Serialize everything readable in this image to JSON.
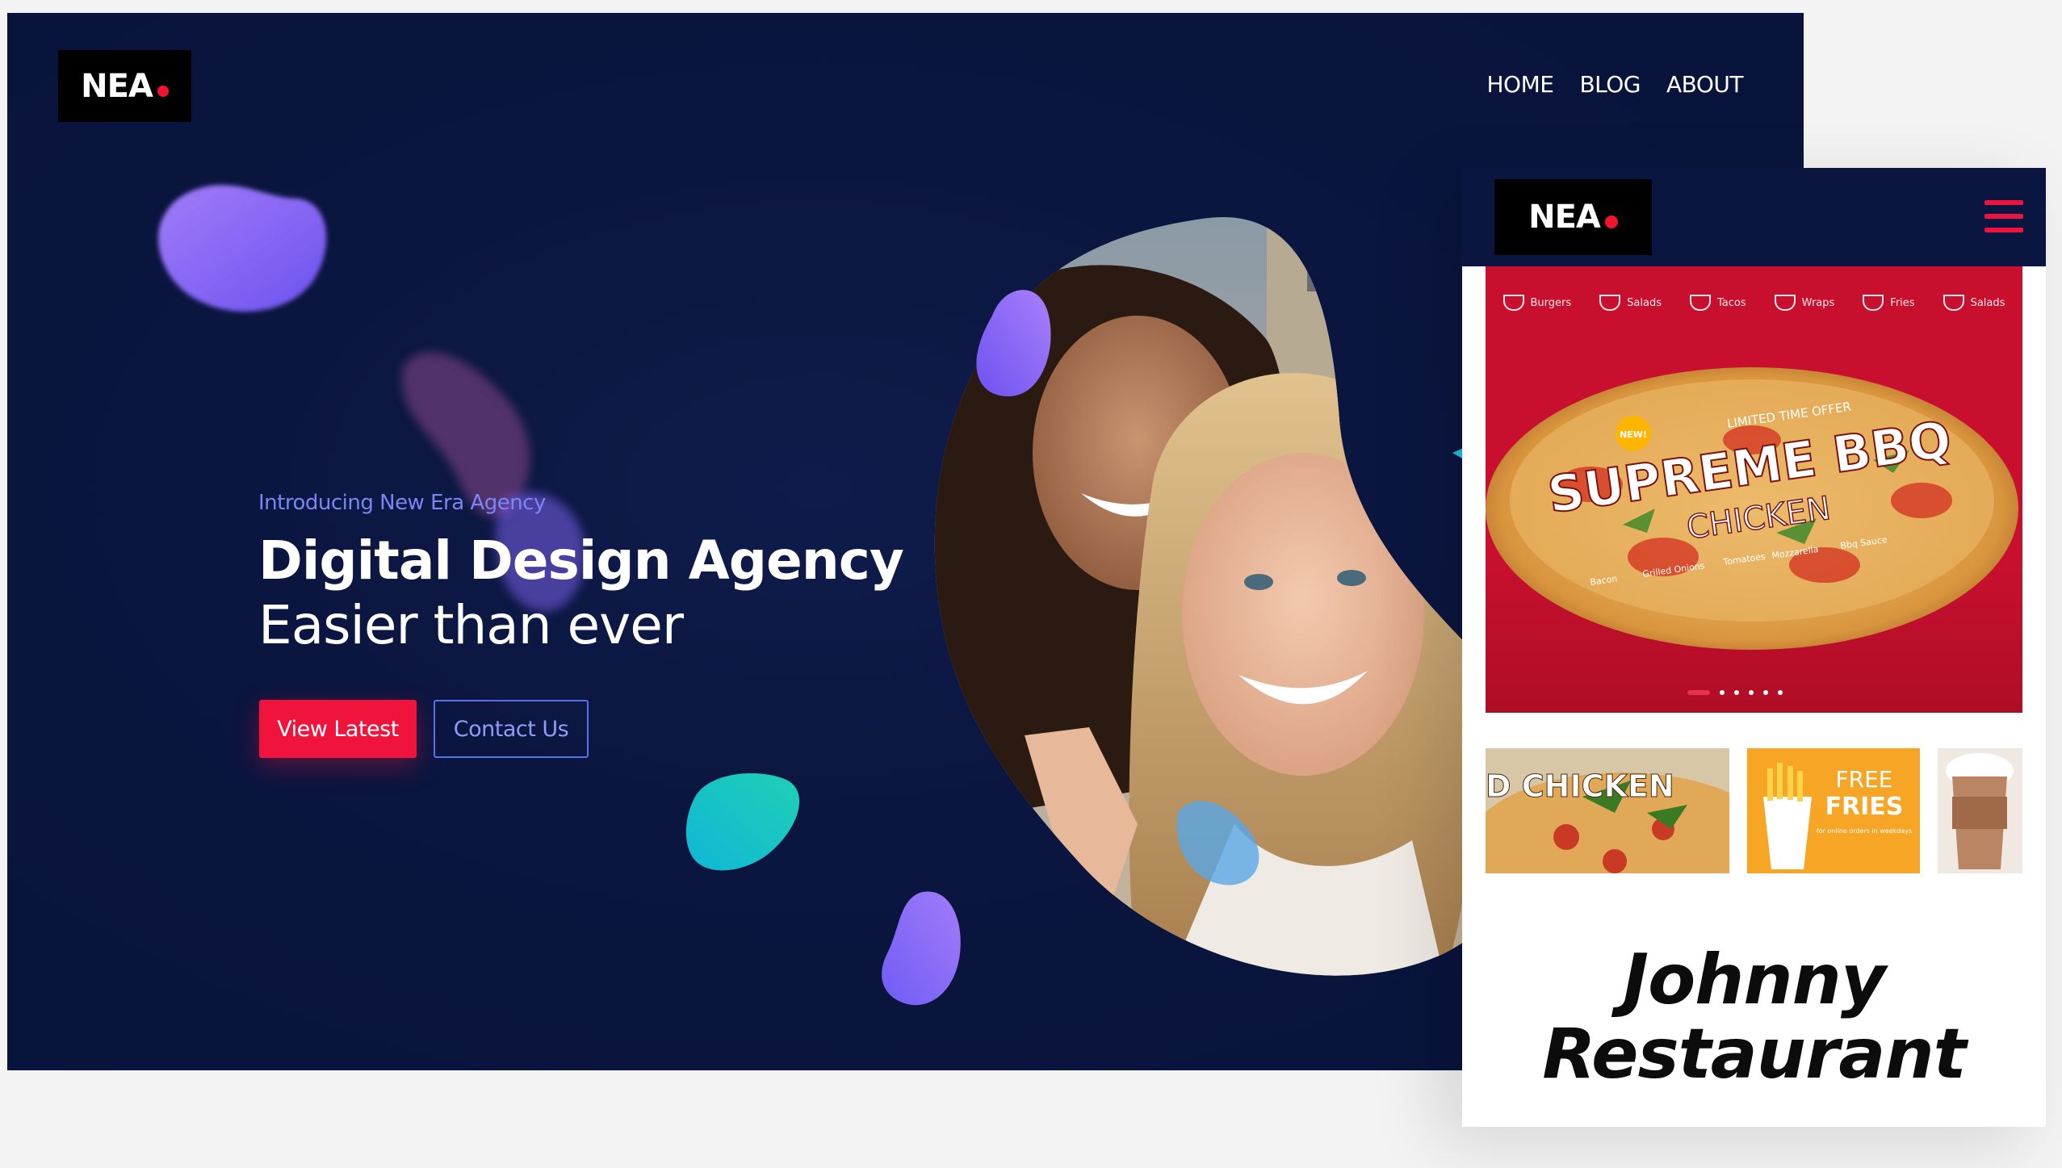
{
  "desktop": {
    "logo": "NEA",
    "nav": [
      "HOME",
      "BLOG",
      "ABOUT"
    ],
    "eyebrow": "Introducing New Era Agency",
    "headline": "Digital Design Agency",
    "subline": "Easier than ever",
    "primary_button": "View Latest",
    "secondary_button": "Contact Us"
  },
  "mobile": {
    "logo": "NEA",
    "categories": [
      "Burgers",
      "Salads",
      "Tacos",
      "Wraps",
      "Fries",
      "Salads"
    ],
    "promo": {
      "badge": "NEW!",
      "kicker": "LIMITED TIME OFFER",
      "title": "SUPREME BBQ",
      "subtitle": "CHICKEN",
      "ingredients": [
        "Bacon",
        "Grilled Onions",
        "Tomatoes",
        "Mozzarella",
        "Bbq Sauce"
      ]
    },
    "thumbs": {
      "t1_label": "D CHICKEN",
      "t2_label_1": "FREE",
      "t2_label_2": "FRIES",
      "t2_small": "for online orders in weekdays"
    },
    "title_line_1": "Johnny",
    "title_line_2": "Restaurant"
  },
  "colors": {
    "navy": "#0b1640",
    "accent_red": "#f0143c",
    "accent_blue": "#5b6fe8",
    "promo_red": "#c8102e"
  }
}
